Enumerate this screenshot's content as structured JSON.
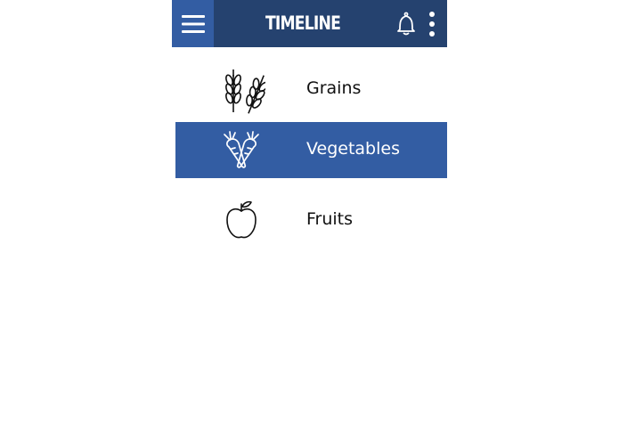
{
  "appbar": {
    "title": "TIMELINE",
    "menu_icon": "hamburger-menu-icon",
    "bell_icon": "bell-icon",
    "more_icon": "more-vertical-icon",
    "bg_color": "#25426f",
    "menu_bg_color": "#335da3"
  },
  "categories": [
    {
      "label": "Grains",
      "icon": "wheat-icon",
      "selected": false
    },
    {
      "label": "Vegetables",
      "icon": "carrot-icon",
      "selected": true
    },
    {
      "label": "Fruits",
      "icon": "apple-icon",
      "selected": false
    }
  ],
  "colors": {
    "selected_bg": "#335da3",
    "selected_text": "#ffffff",
    "text": "#111111"
  }
}
